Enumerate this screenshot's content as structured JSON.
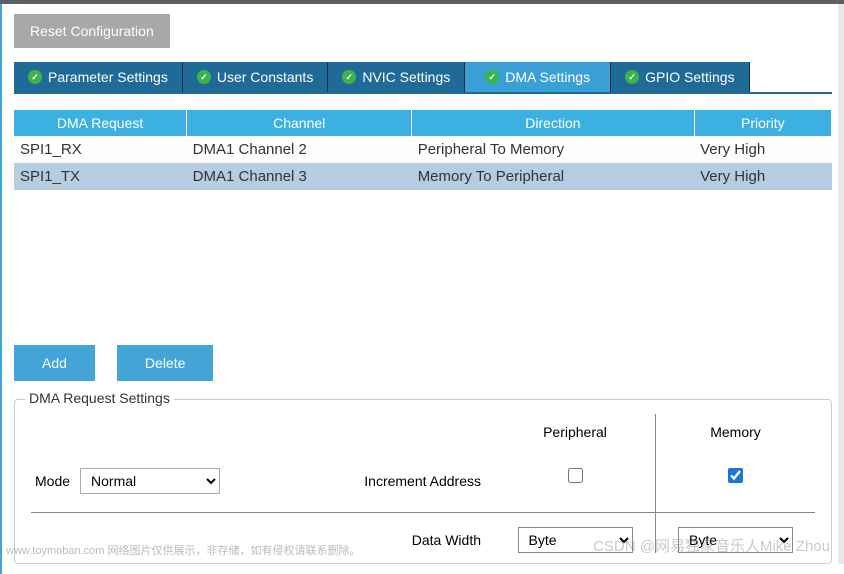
{
  "reset_label": "Reset Configuration",
  "tabs": {
    "param": "Parameter Settings",
    "user": "User Constants",
    "nvic": "NVIC Settings",
    "dma": "DMA Settings",
    "gpio": "GPIO Settings"
  },
  "table": {
    "headers": {
      "req": "DMA Request",
      "ch": "Channel",
      "dir": "Direction",
      "pri": "Priority"
    },
    "rows": [
      {
        "req": "SPI1_RX",
        "ch": "DMA1 Channel 2",
        "dir": "Peripheral To Memory",
        "pri": "Very High"
      },
      {
        "req": "SPI1_TX",
        "ch": "DMA1 Channel 3",
        "dir": "Memory To Peripheral",
        "pri": "Very High"
      }
    ]
  },
  "actions": {
    "add": "Add",
    "delete": "Delete"
  },
  "settings": {
    "legend": "DMA Request Settings",
    "col_periph": "Peripheral",
    "col_mem": "Memory",
    "mode_label": "Mode",
    "mode_value": "Normal",
    "incr_label": "Increment Address",
    "incr_periph": false,
    "incr_mem": true,
    "dw_label": "Data Width",
    "dw_periph": "Byte",
    "dw_mem": "Byte"
  },
  "watermark1": "www.toymoban.com 网络图片仅供展示，非存储，如有侵权请联系删除。",
  "watermark2": "CSDN @网易独家音乐人Mike Zhou"
}
